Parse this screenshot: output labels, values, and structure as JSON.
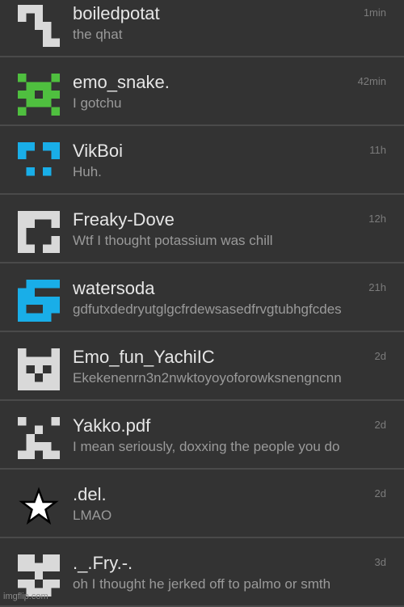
{
  "conversations": [
    {
      "name": "boiledpotat",
      "message": "the qhat",
      "time": "1min",
      "avatar_color": "#d9d9d9",
      "avatar_icon": "identicon-icon"
    },
    {
      "name": "emo_snake.",
      "message": "I gotchu",
      "time": "42min",
      "avatar_color": "#4fbf3f",
      "avatar_icon": "identicon-icon"
    },
    {
      "name": "VikBoi",
      "message": "Huh.",
      "time": "11h",
      "avatar_color": "#19aee8",
      "avatar_icon": "identicon-icon"
    },
    {
      "name": "Freaky-Dove",
      "message": "Wtf I thought potassium was chill",
      "time": "12h",
      "avatar_color": "#d9d9d9",
      "avatar_icon": "identicon-icon"
    },
    {
      "name": "watersoda",
      "message": "gdfutxdedryutglgcfrdewsasedfrvgtubhgfcdes",
      "time": "21h",
      "avatar_color": "#19aee8",
      "avatar_icon": "identicon-icon"
    },
    {
      "name": "Emo_fun_YachiIC",
      "message": "Ekekenenrn3n2nwktoyoyoforowksnengncnn",
      "time": "2d",
      "avatar_color": "#d9d9d9",
      "avatar_icon": "identicon-icon"
    },
    {
      "name": "Yakko.pdf",
      "message": "I mean seriously, doxxing the people you do",
      "time": "2d",
      "avatar_color": "#d9d9d9",
      "avatar_icon": "identicon-icon"
    },
    {
      "name": ".del.",
      "message": "LMAO",
      "time": "2d",
      "avatar_color": "#ffffff",
      "avatar_icon": "star-icon"
    },
    {
      "name": "._.Fry.-.",
      "message": "oh I thought he jerked off to palmo or smth",
      "time": "3d",
      "avatar_color": "#d9d9d9",
      "avatar_icon": "identicon-icon"
    }
  ],
  "watermark": "imgflip.com"
}
